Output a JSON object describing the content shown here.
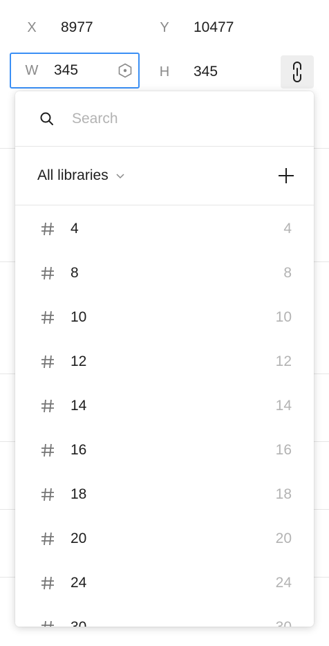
{
  "properties": {
    "x": {
      "label": "X",
      "value": "8977"
    },
    "y": {
      "label": "Y",
      "value": "10477"
    },
    "w": {
      "label": "W",
      "value": "345"
    },
    "h": {
      "label": "H",
      "value": "345"
    }
  },
  "dropdown": {
    "search": {
      "placeholder": "Search",
      "value": ""
    },
    "library_selector": {
      "label": "All libraries"
    },
    "items": [
      {
        "name": "4",
        "value": "4"
      },
      {
        "name": "8",
        "value": "8"
      },
      {
        "name": "10",
        "value": "10"
      },
      {
        "name": "12",
        "value": "12"
      },
      {
        "name": "14",
        "value": "14"
      },
      {
        "name": "16",
        "value": "16"
      },
      {
        "name": "18",
        "value": "18"
      },
      {
        "name": "20",
        "value": "20"
      },
      {
        "name": "24",
        "value": "24"
      },
      {
        "name": "30",
        "value": "30"
      }
    ]
  },
  "colors": {
    "focus_border": "#3a8ff5",
    "muted_text": "#b3b3b3",
    "label_text": "#8a8a8a"
  },
  "icons": [
    "variable-icon",
    "link-icon",
    "search-icon",
    "chevron-down-icon",
    "plus-icon",
    "hash-icon"
  ]
}
